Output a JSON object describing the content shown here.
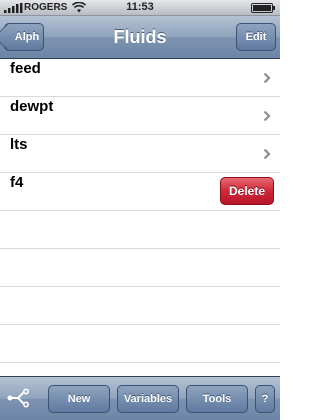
{
  "status_bar": {
    "carrier": "ROGERS",
    "time": "11:53"
  },
  "nav": {
    "back_label": "Alph",
    "title": "Fluids",
    "edit_label": "Edit"
  },
  "rows": [
    {
      "label": "feed"
    },
    {
      "label": "dewpt"
    },
    {
      "label": "lts"
    },
    {
      "label": "f4",
      "delete_label": "Delete"
    }
  ],
  "toolbar": {
    "new_label": "New",
    "variables_label": "Variables",
    "tools_label": "Tools",
    "help_label": "?"
  },
  "colors": {
    "nav_blue": "#6d85a6",
    "delete_red": "#d1283a",
    "chevron_gray": "#8e8e8e"
  }
}
